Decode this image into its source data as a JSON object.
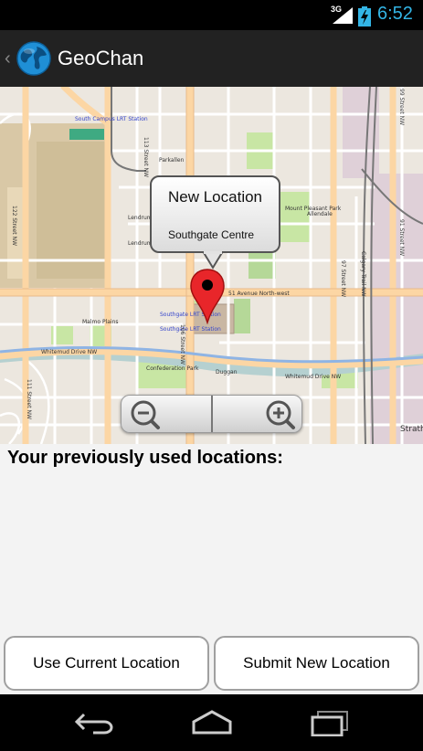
{
  "status_bar": {
    "signal_label": "3G",
    "time": "6:52",
    "accent": "#33b5e5"
  },
  "action_bar": {
    "title": "GeoChan",
    "up_glyph": "‹",
    "logo_icon": "globe-icon"
  },
  "map": {
    "callout_title": "New Location",
    "callout_subtitle": "Southgate Centre",
    "labels": {
      "south_campus": "South Campus LRT Station",
      "st_113": "113 Street NW",
      "parkallen": "Parkallen",
      "st_122": "122 Street NW",
      "lendrum": "Lendrum",
      "lendrum_place": "Lendrum Place P",
      "mount_pleasant": "Mount Pleasant Park",
      "allendale": "Allendale",
      "ave_51": "51 Avenue North-west",
      "st_106": "106 Street NW",
      "southgate_lrt": "Southgate LRT Station",
      "southgate_lrt2": "Southgate LRT Station",
      "malmo": "Malmo Plains",
      "whitemud": "Whitemud Drive NW",
      "whitemud2": "Whitemud Drive NW",
      "confederation": "Confederation Park",
      "duggan": "Duggan",
      "st_111": "111 Street NW",
      "calgary_trail": "Calgary Trail NW",
      "st_99": "99 Street NW",
      "st_97": "97 Street NW",
      "st_91": "91 Street NW",
      "strath": "Strath"
    },
    "colors": {
      "water": "#b5d0d0",
      "park": "#c8e6a4",
      "road_major": "#fcd6a4",
      "road_minor": "#ffffff",
      "industrial": "#dfd0d8",
      "rail": "#888888"
    },
    "zoom_controls": {
      "zoom_out_icon": "zoom-out-icon",
      "zoom_in_icon": "zoom-in-icon"
    }
  },
  "content": {
    "heading": "Your previously used locations:",
    "locations": []
  },
  "buttons": {
    "use_current": "Use Current Location",
    "submit_new": "Submit New Location"
  },
  "nav_bar": {
    "back_icon": "back-icon",
    "home_icon": "home-icon",
    "recents_icon": "recent-apps-icon"
  }
}
